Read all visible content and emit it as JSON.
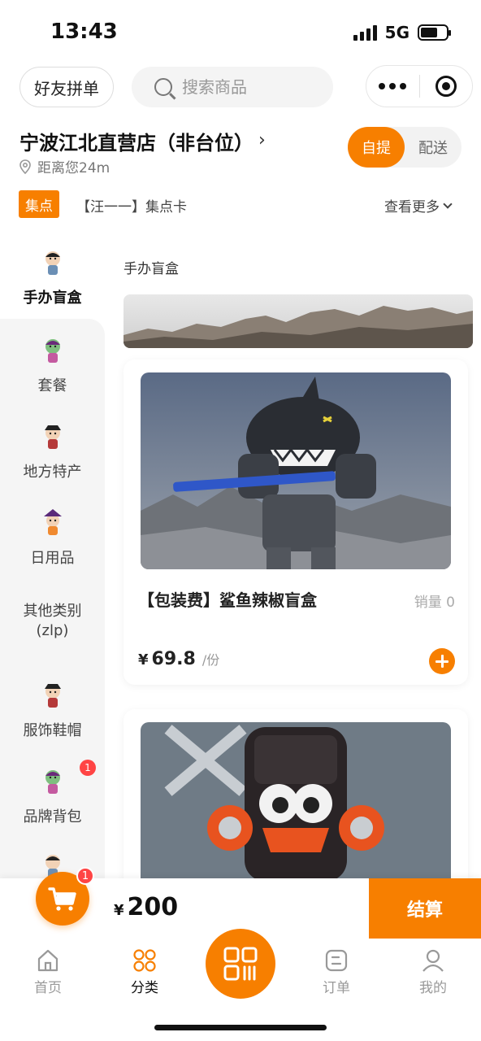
{
  "status_bar": {
    "time": "13:43",
    "network": "5G"
  },
  "header": {
    "friend_group_label": "好友拼单",
    "search_placeholder": "搜索商品"
  },
  "store": {
    "name": "宁波江北直营店（非台位）",
    "arrow": "›",
    "distance": "距离您24m",
    "mode_pickup": "自提",
    "mode_delivery": "配送"
  },
  "stamp": {
    "badge": "集点",
    "card_name": "【汪一一】集点卡",
    "see_more": "查看更多"
  },
  "sidebar": {
    "items": [
      {
        "label": "手办盲盒",
        "active": true
      },
      {
        "label": "套餐"
      },
      {
        "label": "地方特产"
      },
      {
        "label": "日用品"
      },
      {
        "label": "其他类别",
        "label2": "(zlp)"
      },
      {
        "label": "服饰鞋帽"
      },
      {
        "label": "品牌背包",
        "badge": "1"
      }
    ]
  },
  "content": {
    "section_title": "手办盲盒",
    "products": [
      {
        "name": "【包装费】鲨鱼辣椒盲盒",
        "sales": "销量 0",
        "currency": "¥",
        "price": "69.8",
        "unit": "/份"
      }
    ]
  },
  "checkout": {
    "cart_count": "1",
    "currency": "¥",
    "total": "200",
    "pay_label": "结算"
  },
  "tabbar": {
    "items": [
      {
        "label": "首页"
      },
      {
        "label": "分类",
        "active": true
      },
      {
        "label": "订单"
      },
      {
        "label": "我的"
      }
    ]
  },
  "colors": {
    "accent": "#f77f00",
    "badge": "#ff4444"
  }
}
